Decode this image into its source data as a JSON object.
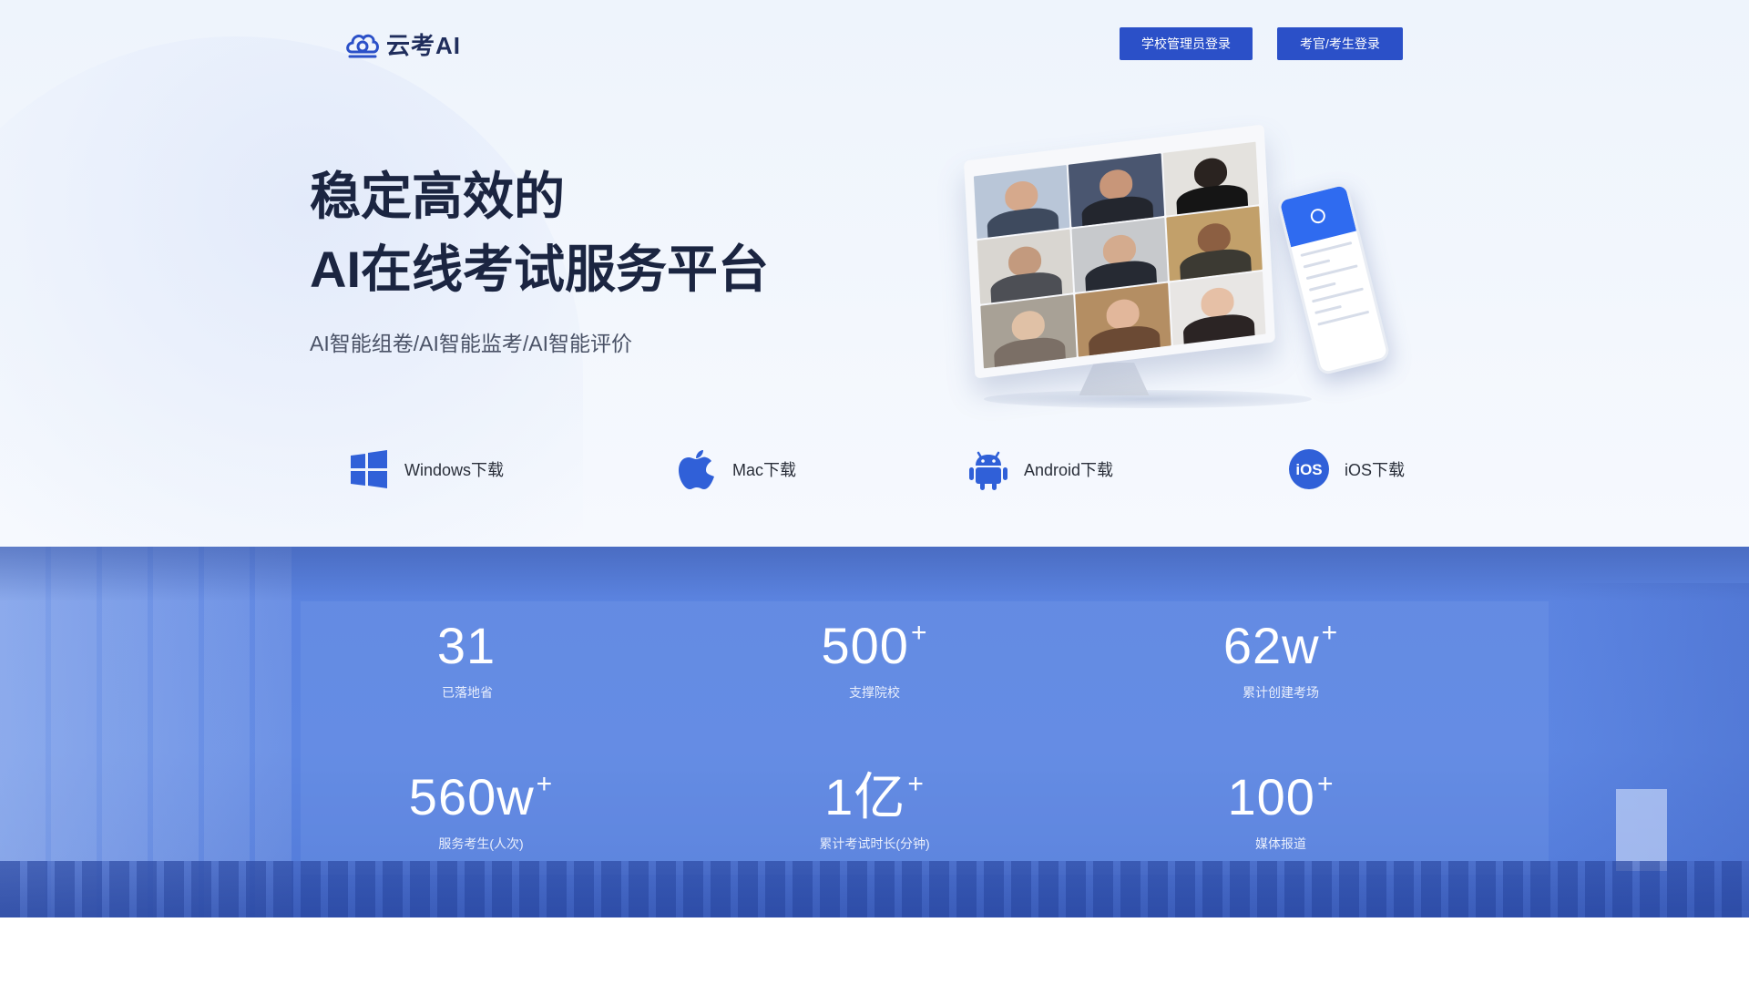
{
  "brand": {
    "name": "云考AI",
    "color": "#2b50c8",
    "logo_icon": "cloud-exam-logo-icon"
  },
  "header": {
    "school_login_label": "学校管理员登录",
    "proctor_login_label": "考官/考生登录"
  },
  "hero": {
    "headline_line1": "稳定高效的",
    "headline_line2": "AI在线考试服务平台",
    "subtitle": "AI智能组卷/AI智能监考/AI智能评价"
  },
  "downloads": [
    {
      "label": "Windows下载",
      "icon": "windows-icon"
    },
    {
      "label": "Mac下载",
      "icon": "apple-icon"
    },
    {
      "label": "Android下载",
      "icon": "android-icon"
    },
    {
      "label": "iOS下载",
      "icon": "ios-icon"
    }
  ],
  "stats": [
    {
      "value": "31",
      "suffix": "",
      "label": "已落地省"
    },
    {
      "value": "500",
      "suffix": "+",
      "label": "支撑院校"
    },
    {
      "value": "62w",
      "suffix": "+",
      "label": "累计创建考场"
    },
    {
      "value": "560w",
      "suffix": "+",
      "label": "服务考生(人次)"
    },
    {
      "value": "1亿",
      "suffix": "+",
      "label": "累计考试时长(分钟)"
    },
    {
      "value": "100",
      "suffix": "+",
      "label": "媒体报道"
    }
  ],
  "colors": {
    "accent": "#2b50c8",
    "stats_bg": "#5b83e0",
    "headline": "#1b2541"
  }
}
